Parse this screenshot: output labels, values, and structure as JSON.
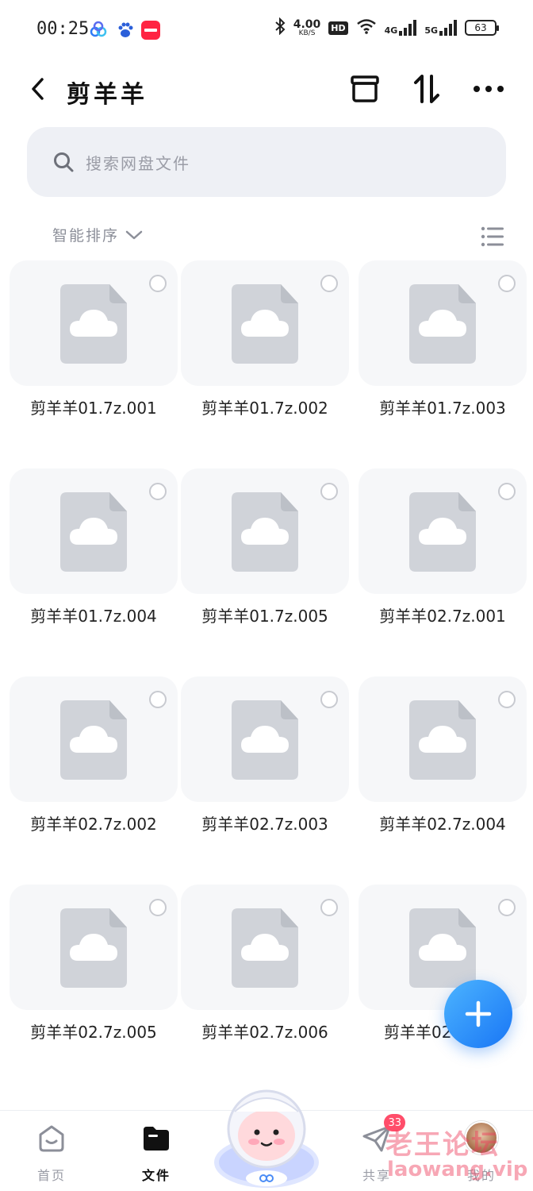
{
  "status_bar": {
    "time": "00:25",
    "net_speed_value": "4.00",
    "net_speed_unit": "KB/S",
    "hd_label": "HD",
    "signal_1": "4G",
    "signal_2": "5G",
    "battery": "63"
  },
  "header": {
    "title": "剪羊羊"
  },
  "search": {
    "placeholder": "搜索网盘文件"
  },
  "sort": {
    "label": "智能排序"
  },
  "files": [
    {
      "name": "剪羊羊01.7z.001"
    },
    {
      "name": "剪羊羊01.7z.002"
    },
    {
      "name": "剪羊羊01.7z.003"
    },
    {
      "name": "剪羊羊01.7z.004"
    },
    {
      "name": "剪羊羊01.7z.005"
    },
    {
      "name": "剪羊羊02.7z.001"
    },
    {
      "name": "剪羊羊02.7z.002"
    },
    {
      "name": "剪羊羊02.7z.003"
    },
    {
      "name": "剪羊羊02.7z.004"
    },
    {
      "name": "剪羊羊02.7z.005"
    },
    {
      "name": "剪羊羊02.7z.006"
    },
    {
      "name": "剪羊羊02"
    }
  ],
  "bottom_nav": {
    "home": "首页",
    "files": "文件",
    "share": "共享",
    "share_badge": "33",
    "mine": "我的"
  },
  "watermark": {
    "cn": "老王论坛",
    "en": "laowang.vip"
  },
  "colors": {
    "accent": "#1976f5",
    "badge": "#ff4d6a",
    "search_bg": "#eef0f5",
    "tile_bg": "#f6f7f9"
  }
}
